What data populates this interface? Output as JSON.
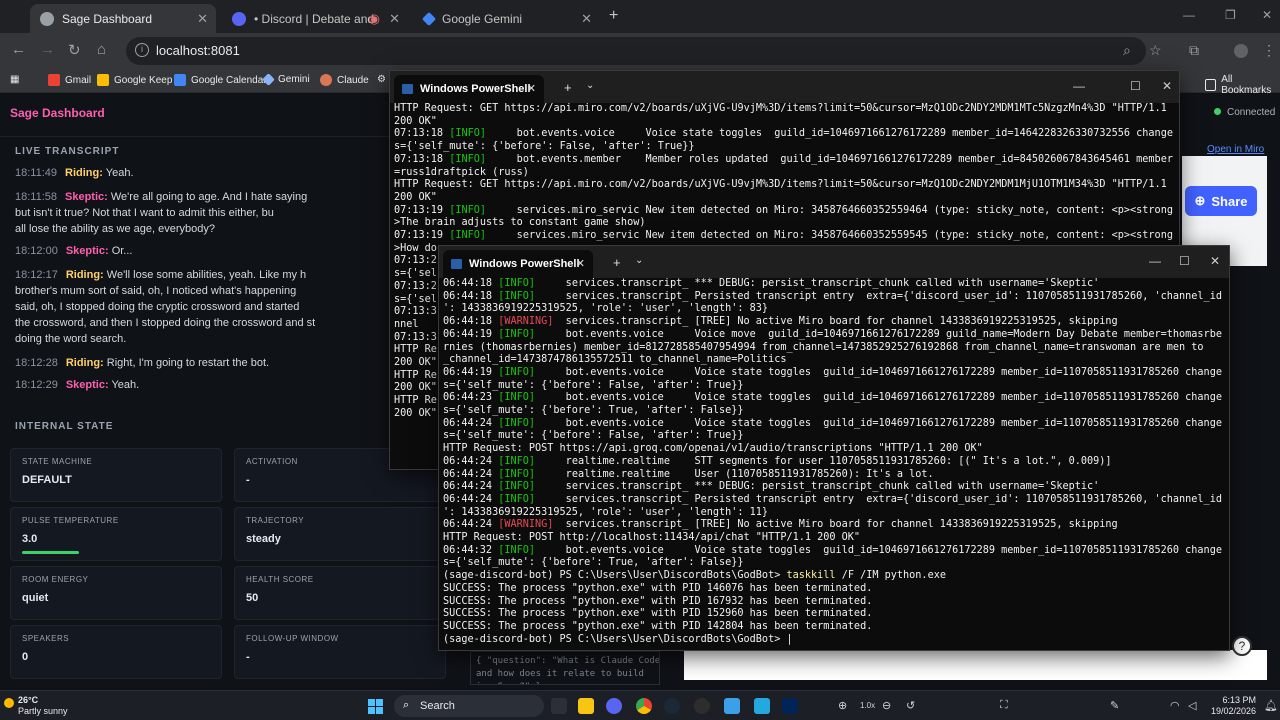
{
  "browser": {
    "tabs": [
      {
        "title": "Sage Dashboard"
      },
      {
        "title": "• Discord | Debate and let Sage h"
      },
      {
        "title": "Google Gemini"
      }
    ],
    "url": "localhost:8081",
    "bookmarks": [
      "Gmail",
      "Google Keep",
      "Google Calendar",
      "Gemini",
      "Claude"
    ],
    "all_bookmarks": "All Bookmarks"
  },
  "dashboard": {
    "title": "Sage Dashboard",
    "connection": "Connected",
    "open_miro": "Open in Miro",
    "share": "Share",
    "transcript_label": "LIVE TRANSCRIPT",
    "transcript": [
      {
        "time": "18:11:49",
        "speaker": "Riding:",
        "kind": "r",
        "text": "Yeah."
      },
      {
        "time": "18:11:58",
        "speaker": "Skeptic:",
        "kind": "s",
        "text": "We're all going to age. And I hate saying"
      },
      {
        "time": "",
        "speaker": "",
        "kind": "",
        "text": "but isn't it true? Not that I want to admit this either, bu"
      },
      {
        "time": "",
        "speaker": "",
        "kind": "",
        "text": "all lose the ability as we age, everybody?"
      },
      {
        "time": "18:12:00",
        "speaker": "Skeptic:",
        "kind": "s",
        "text": "Or..."
      },
      {
        "time": "18:12:17",
        "speaker": "Riding:",
        "kind": "r",
        "text": "We'll lose some abilities, yeah. Like my h"
      },
      {
        "time": "",
        "speaker": "",
        "kind": "",
        "text": "brother's mum sort of said, oh, I noticed what's happening"
      },
      {
        "time": "",
        "speaker": "",
        "kind": "",
        "text": "said, oh, I stopped doing the cryptic crossword and started"
      },
      {
        "time": "",
        "speaker": "",
        "kind": "",
        "text": "the crossword, and then I stopped doing the crossword and st"
      },
      {
        "time": "",
        "speaker": "",
        "kind": "",
        "text": "doing the word search."
      },
      {
        "time": "18:12:28",
        "speaker": "Riding:",
        "kind": "r",
        "text": "Right, I'm going to restart the bot."
      },
      {
        "time": "18:12:29",
        "speaker": "Skeptic:",
        "kind": "s",
        "text": "Yeah."
      }
    ],
    "internal_label": "INTERNAL STATE",
    "cards": [
      {
        "label": "STATE MACHINE",
        "value": "DEFAULT"
      },
      {
        "label": "ACTIVATION",
        "value": "-"
      },
      {
        "label": "PULSE TEMPERATURE",
        "value": "3.0"
      },
      {
        "label": "TRAJECTORY",
        "value": "steady"
      },
      {
        "label": "ROOM ENERGY",
        "value": "quiet"
      },
      {
        "label": "HEALTH SCORE",
        "value": "50"
      },
      {
        "label": "SPEAKERS",
        "value": "0"
      },
      {
        "label": "FOLLOW-UP WINDOW",
        "value": "-"
      }
    ],
    "pulse_fraction": 0.3,
    "question_chip": "{ \"question\": \"What is Claude Code\nand how does it relate to build\ning Sage?\" }"
  },
  "ps_back": {
    "title": "Windows PowerShell",
    "lines": [
      [
        [
          "w",
          "HTTP Request: GET https://api.miro.com/v2/boards/uXjVG-U9vjM%3D/items?limit=50&cursor=MzQ1ODc2NDY2MDM1MTc5NzgzMn4%3D \"HTTP/1.1"
        ]
      ],
      [
        [
          "w",
          "200 OK\""
        ]
      ],
      [
        [
          "w",
          "07:13:18 "
        ],
        [
          "g",
          "[INFO]"
        ],
        [
          "w",
          "     bot.events.voice     Voice state toggles  guild_id=1046971661276172289 member_id=1464228326330732556 change"
        ]
      ],
      [
        [
          "w",
          "s={'self_mute': {'before': False, 'after': True}}"
        ]
      ],
      [
        [
          "w",
          "07:13:18 "
        ],
        [
          "g",
          "[INFO]"
        ],
        [
          "w",
          "     bot.events.member    Member roles updated  guild_id=1046971661276172289 member_id=845026067843645461 member"
        ]
      ],
      [
        [
          "w",
          "=russ1draftpick (russ)"
        ]
      ],
      [
        [
          "w",
          "HTTP Request: GET https://api.miro.com/v2/boards/uXjVG-U9vjM%3D/items?limit=50&cursor=MzQ1ODc2NDY2MDM1MjU1OTM1M34%3D \"HTTP/1.1"
        ]
      ],
      [
        [
          "w",
          "200 OK\""
        ]
      ],
      [
        [
          "w",
          "07:13:19 "
        ],
        [
          "g",
          "[INFO]"
        ],
        [
          "w",
          "     services.miro_servic New item detected on Miro: 3458764660352559464 (type: sticky_note, content: <p><strong"
        ]
      ],
      [
        [
          "w",
          ">The brain adjusts to constant game show)"
        ]
      ],
      [
        [
          "w",
          "07:13:19 "
        ],
        [
          "g",
          "[INFO]"
        ],
        [
          "w",
          "     services.miro_servic New item detected on Miro: 3458764660352559545 (type: sticky_note, content: <p><strong"
        ]
      ],
      [
        [
          "w",
          ">How do"
        ]
      ],
      [
        [
          "w",
          "07:13:2"
        ]
      ],
      [
        [
          "w",
          "s={'sel"
        ]
      ],
      [
        [
          "w",
          "07:13:2"
        ]
      ],
      [
        [
          "w",
          "s={'sel"
        ]
      ],
      [
        [
          "w",
          "07:13:3"
        ]
      ],
      [
        [
          "w",
          "nnel"
        ]
      ],
      [
        [
          "w",
          "07:13:3"
        ]
      ],
      [
        [
          "w",
          "HTTP Re"
        ]
      ],
      [
        [
          "w",
          "200 OK\""
        ]
      ],
      [
        [
          "w",
          "HTTP Re"
        ]
      ],
      [
        [
          "w",
          "200 OK\""
        ]
      ],
      [
        [
          "w",
          "HTTP Re"
        ]
      ],
      [
        [
          "w",
          "200 OK\""
        ]
      ]
    ]
  },
  "ps_front": {
    "title": "Windows PowerShell",
    "lines": [
      [
        [
          "w",
          "06:44:18 "
        ],
        [
          "g",
          "[INFO]"
        ],
        [
          "w",
          "     services.transcript_ *** DEBUG: persist_transcript_chunk called with username='Skeptic'"
        ]
      ],
      [
        [
          "w",
          "06:44:18 "
        ],
        [
          "g",
          "[INFO]"
        ],
        [
          "w",
          "     services.transcript_ Persisted transcript entry  extra={'discord_user_id': 1107058511931785260, 'channel_id"
        ]
      ],
      [
        [
          "w",
          "': 1433836919225319525, 'role': 'user', 'length': 83}"
        ]
      ],
      [
        [
          "w",
          "06:44:18 "
        ],
        [
          "r",
          "[WARNING]"
        ],
        [
          "w",
          "  services.transcript_ [TREE] No active Miro board for channel 1433836919225319525, skipping"
        ]
      ],
      [
        [
          "w",
          "06:44:19 "
        ],
        [
          "g",
          "[INFO]"
        ],
        [
          "w",
          "     bot.events.voice     Voice move  guild_id=1046971661276172289 guild_name=Modern Day Debate member=thomasrbe"
        ]
      ],
      [
        [
          "w",
          "rnies (thomasrbernies) member_id=812728585407954994 from_channel=1473852925276192868 from_channel_name=transwoman are men to"
        ]
      ],
      [
        [
          "w",
          "_channel_id=1473874786135572511 to_channel_name=Politics"
        ]
      ],
      [
        [
          "w",
          "06:44:19 "
        ],
        [
          "g",
          "[INFO]"
        ],
        [
          "w",
          "     bot.events.voice     Voice state toggles  guild_id=1046971661276172289 member_id=1107058511931785260 change"
        ]
      ],
      [
        [
          "w",
          "s={'self_mute': {'before': False, 'after': True}}"
        ]
      ],
      [
        [
          "w",
          "06:44:23 "
        ],
        [
          "g",
          "[INFO]"
        ],
        [
          "w",
          "     bot.events.voice     Voice state toggles  guild_id=1046971661276172289 member_id=1107058511931785260 change"
        ]
      ],
      [
        [
          "w",
          "s={'self_mute': {'before': True, 'after': False}}"
        ]
      ],
      [
        [
          "w",
          "06:44:24 "
        ],
        [
          "g",
          "[INFO]"
        ],
        [
          "w",
          "     bot.events.voice     Voice state toggles  guild_id=1046971661276172289 member_id=1107058511931785260 change"
        ]
      ],
      [
        [
          "w",
          "s={'self_mute': {'before': False, 'after': True}}"
        ]
      ],
      [
        [
          "w",
          "HTTP Request: POST https://api.groq.com/openai/v1/audio/transcriptions \"HTTP/1.1 200 OK\""
        ]
      ],
      [
        [
          "w",
          "06:44:24 "
        ],
        [
          "g",
          "[INFO]"
        ],
        [
          "w",
          "     realtime.realtime    STT segments for user 1107058511931785260: [(\" It's a lot.\", 0.009)]"
        ]
      ],
      [
        [
          "w",
          "06:44:24 "
        ],
        [
          "g",
          "[INFO]"
        ],
        [
          "w",
          "     realtime.realtime    User (1107058511931785260): It's a lot."
        ]
      ],
      [
        [
          "w",
          "06:44:24 "
        ],
        [
          "g",
          "[INFO]"
        ],
        [
          "w",
          "     services.transcript_ *** DEBUG: persist_transcript_chunk called with username='Skeptic'"
        ]
      ],
      [
        [
          "w",
          "06:44:24 "
        ],
        [
          "g",
          "[INFO]"
        ],
        [
          "w",
          "     services.transcript_ Persisted transcript entry  extra={'discord_user_id': 1107058511931785260, 'channel_id"
        ]
      ],
      [
        [
          "w",
          "': 1433836919225319525, 'role': 'user', 'length': 11}"
        ]
      ],
      [
        [
          "w",
          "06:44:24 "
        ],
        [
          "r",
          "[WARNING]"
        ],
        [
          "w",
          "  services.transcript_ [TREE] No active Miro board for channel 1433836919225319525, skipping"
        ]
      ],
      [
        [
          "w",
          "HTTP Request: POST http://localhost:11434/api/chat \"HTTP/1.1 200 OK\""
        ]
      ],
      [
        [
          "w",
          "06:44:32 "
        ],
        [
          "g",
          "[INFO]"
        ],
        [
          "w",
          "     bot.events.voice     Voice state toggles  guild_id=1046971661276172289 member_id=1107058511931785260 change"
        ]
      ],
      [
        [
          "w",
          "s={'self_mute': {'before': True, 'after': False}}"
        ]
      ],
      [
        [
          "w",
          "(sage-discord-bot) PS C:\\Users\\User\\DiscordBots\\GodBot> "
        ],
        [
          "y",
          "taskkill"
        ],
        [
          "w",
          " /F /IM python.exe"
        ]
      ],
      [
        [
          "w",
          "SUCCESS: The process \"python.exe\" with PID 146076 has been terminated."
        ]
      ],
      [
        [
          "w",
          "SUCCESS: The process \"python.exe\" with PID 167932 has been terminated."
        ]
      ],
      [
        [
          "w",
          "SUCCESS: The process \"python.exe\" with PID 152960 has been terminated."
        ]
      ],
      [
        [
          "w",
          "SUCCESS: The process \"python.exe\" with PID 142804 has been terminated."
        ]
      ],
      [
        [
          "w",
          "(sage-discord-bot) PS C:\\Users\\User\\DiscordBots\\GodBot> |"
        ]
      ]
    ]
  },
  "taskbar": {
    "temp": "26°C",
    "weather": "Partly sunny",
    "search": "Search",
    "time": "6:13 PM",
    "date": "19/02/2026"
  }
}
